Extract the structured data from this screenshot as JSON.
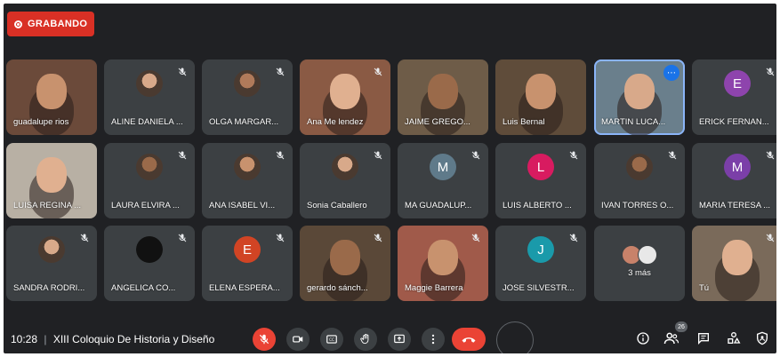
{
  "recording": {
    "label": "GRABANDO",
    "color": "#d93025"
  },
  "participants": [
    {
      "name": "guadalupe rios",
      "type": "video",
      "bg": "#6b4a3a",
      "muted": false
    },
    {
      "name": "ALINE DANIELA ...",
      "type": "photo",
      "bg": "#3c4043",
      "muted": true
    },
    {
      "name": "OLGA MARGAR...",
      "type": "photo",
      "bg": "#3c4043",
      "muted": true
    },
    {
      "name": "Ana Me lendez",
      "type": "video",
      "bg": "#8a5a44",
      "muted": true
    },
    {
      "name": "JAIME GREGO...",
      "type": "video",
      "bg": "#6e5c48",
      "muted": false
    },
    {
      "name": "Luis Bernal",
      "type": "video",
      "bg": "#5f4c3a",
      "muted": false
    },
    {
      "name": "MARTIN LUCA...",
      "type": "video",
      "bg": "#6a7f8c",
      "muted": false,
      "active": true
    },
    {
      "name": "ERICK FERNAN...",
      "type": "letter",
      "letter": "E",
      "color": "#8e44ad",
      "muted": true
    },
    {
      "name": "LUISA REGINA ...",
      "type": "video",
      "bg": "#b8b0a4",
      "muted": false
    },
    {
      "name": "LAURA ELVIRA ...",
      "type": "photo",
      "bg": "#3c4043",
      "muted": true
    },
    {
      "name": "ANA ISABEL VI...",
      "type": "photo",
      "bg": "#3c4043",
      "muted": true
    },
    {
      "name": "Sonia Caballero",
      "type": "photo",
      "bg": "#3c4043",
      "muted": true
    },
    {
      "name": "MA GUADALUP...",
      "type": "letter",
      "letter": "M",
      "color": "#5f7a8a",
      "muted": true
    },
    {
      "name": "LUIS ALBERTO ...",
      "type": "letter",
      "letter": "L",
      "color": "#d81b60",
      "muted": true
    },
    {
      "name": "IVAN TORRES O...",
      "type": "photo",
      "bg": "#3c4043",
      "muted": true
    },
    {
      "name": "MARIA TERESA ...",
      "type": "letter",
      "letter": "M",
      "color": "#7b3fa8",
      "muted": true
    },
    {
      "name": "SANDRA RODRI...",
      "type": "photo",
      "bg": "#3c4043",
      "muted": true
    },
    {
      "name": "ANGELICA CO...",
      "type": "photo",
      "bg": "#3c4043",
      "muted": true
    },
    {
      "name": "ELENA ESPERA...",
      "type": "letter",
      "letter": "E",
      "color": "#d14424",
      "muted": true
    },
    {
      "name": "gerardo sánch...",
      "type": "video",
      "bg": "#5a4838",
      "muted": true
    },
    {
      "name": "Maggie Barrera",
      "type": "video",
      "bg": "#a05a4a",
      "muted": true
    },
    {
      "name": "JOSE SILVESTR...",
      "type": "letter",
      "letter": "J",
      "color": "#1a9aaa",
      "muted": true
    },
    {
      "name": "3 más",
      "type": "more",
      "muted": false
    },
    {
      "name": "Tú",
      "type": "video",
      "bg": "#7a6a5a",
      "muted": true
    }
  ],
  "bottom": {
    "time": "10:28",
    "separator": "|",
    "meeting_title": "XIII Coloquio De Historia y Diseño",
    "people_count": "26"
  },
  "icons": [
    "mic-off-icon",
    "camera-icon",
    "captions-icon",
    "raise-hand-icon",
    "present-icon",
    "more-options-icon",
    "hang-up-icon",
    "info-icon",
    "people-icon",
    "chat-icon",
    "activities-icon",
    "host-controls-icon"
  ]
}
